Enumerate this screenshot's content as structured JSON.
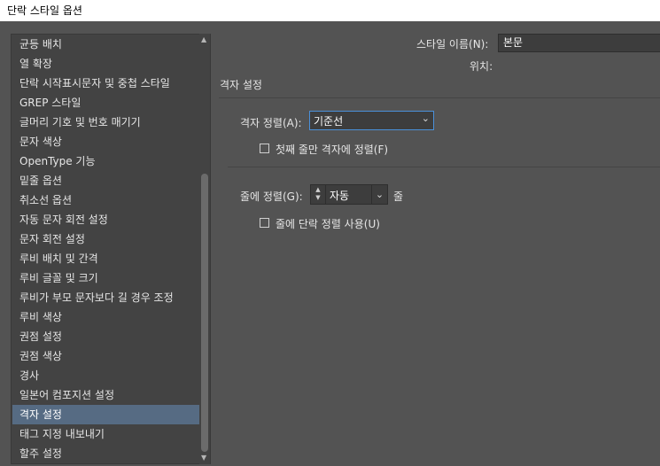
{
  "window": {
    "title": "단락 스타일 옵션"
  },
  "sidebar": {
    "items": [
      "균등 배치",
      "열 확장",
      "단락 시작표시문자 및 중첩 스타일",
      "GREP 스타일",
      "글머리 기호 및 번호 매기기",
      "문자 색상",
      "OpenType 기능",
      "밑줄 옵션",
      "취소선 옵션",
      "자동 문자 회전 설정",
      "문자 회전 설정",
      "루비 배치 및 간격",
      "루비 글꼴 및 크기",
      "루비가 부모 문자보다 길 경우 조정",
      "루비 색상",
      "권점 설정",
      "권점 색상",
      "경사",
      "일본어 컴포지션 설정",
      "격자 설정",
      "태그 지정 내보내기",
      "할주 설정"
    ],
    "selected_index": 19
  },
  "header": {
    "style_name_label": "스타일 이름(N):",
    "style_name_value": "본문",
    "location_label": "위치:"
  },
  "section": {
    "title": "격자 설정"
  },
  "grid_alignment": {
    "label": "격자 정렬(A):",
    "value": "기준선"
  },
  "first_line_only": {
    "label": "첫째 줄만 격자에 정렬(F)",
    "checked": false
  },
  "line_alignment": {
    "label": "줄에 정렬(G):",
    "value": "자동",
    "unit": "줄"
  },
  "use_paragraph_alignment": {
    "label": "줄에 단락 정렬 사용(U)",
    "checked": false
  },
  "colors": {
    "dialog_bg": "#535353",
    "list_bg": "#434343",
    "selection": "#566b83",
    "focus_border": "#4a90d9"
  }
}
